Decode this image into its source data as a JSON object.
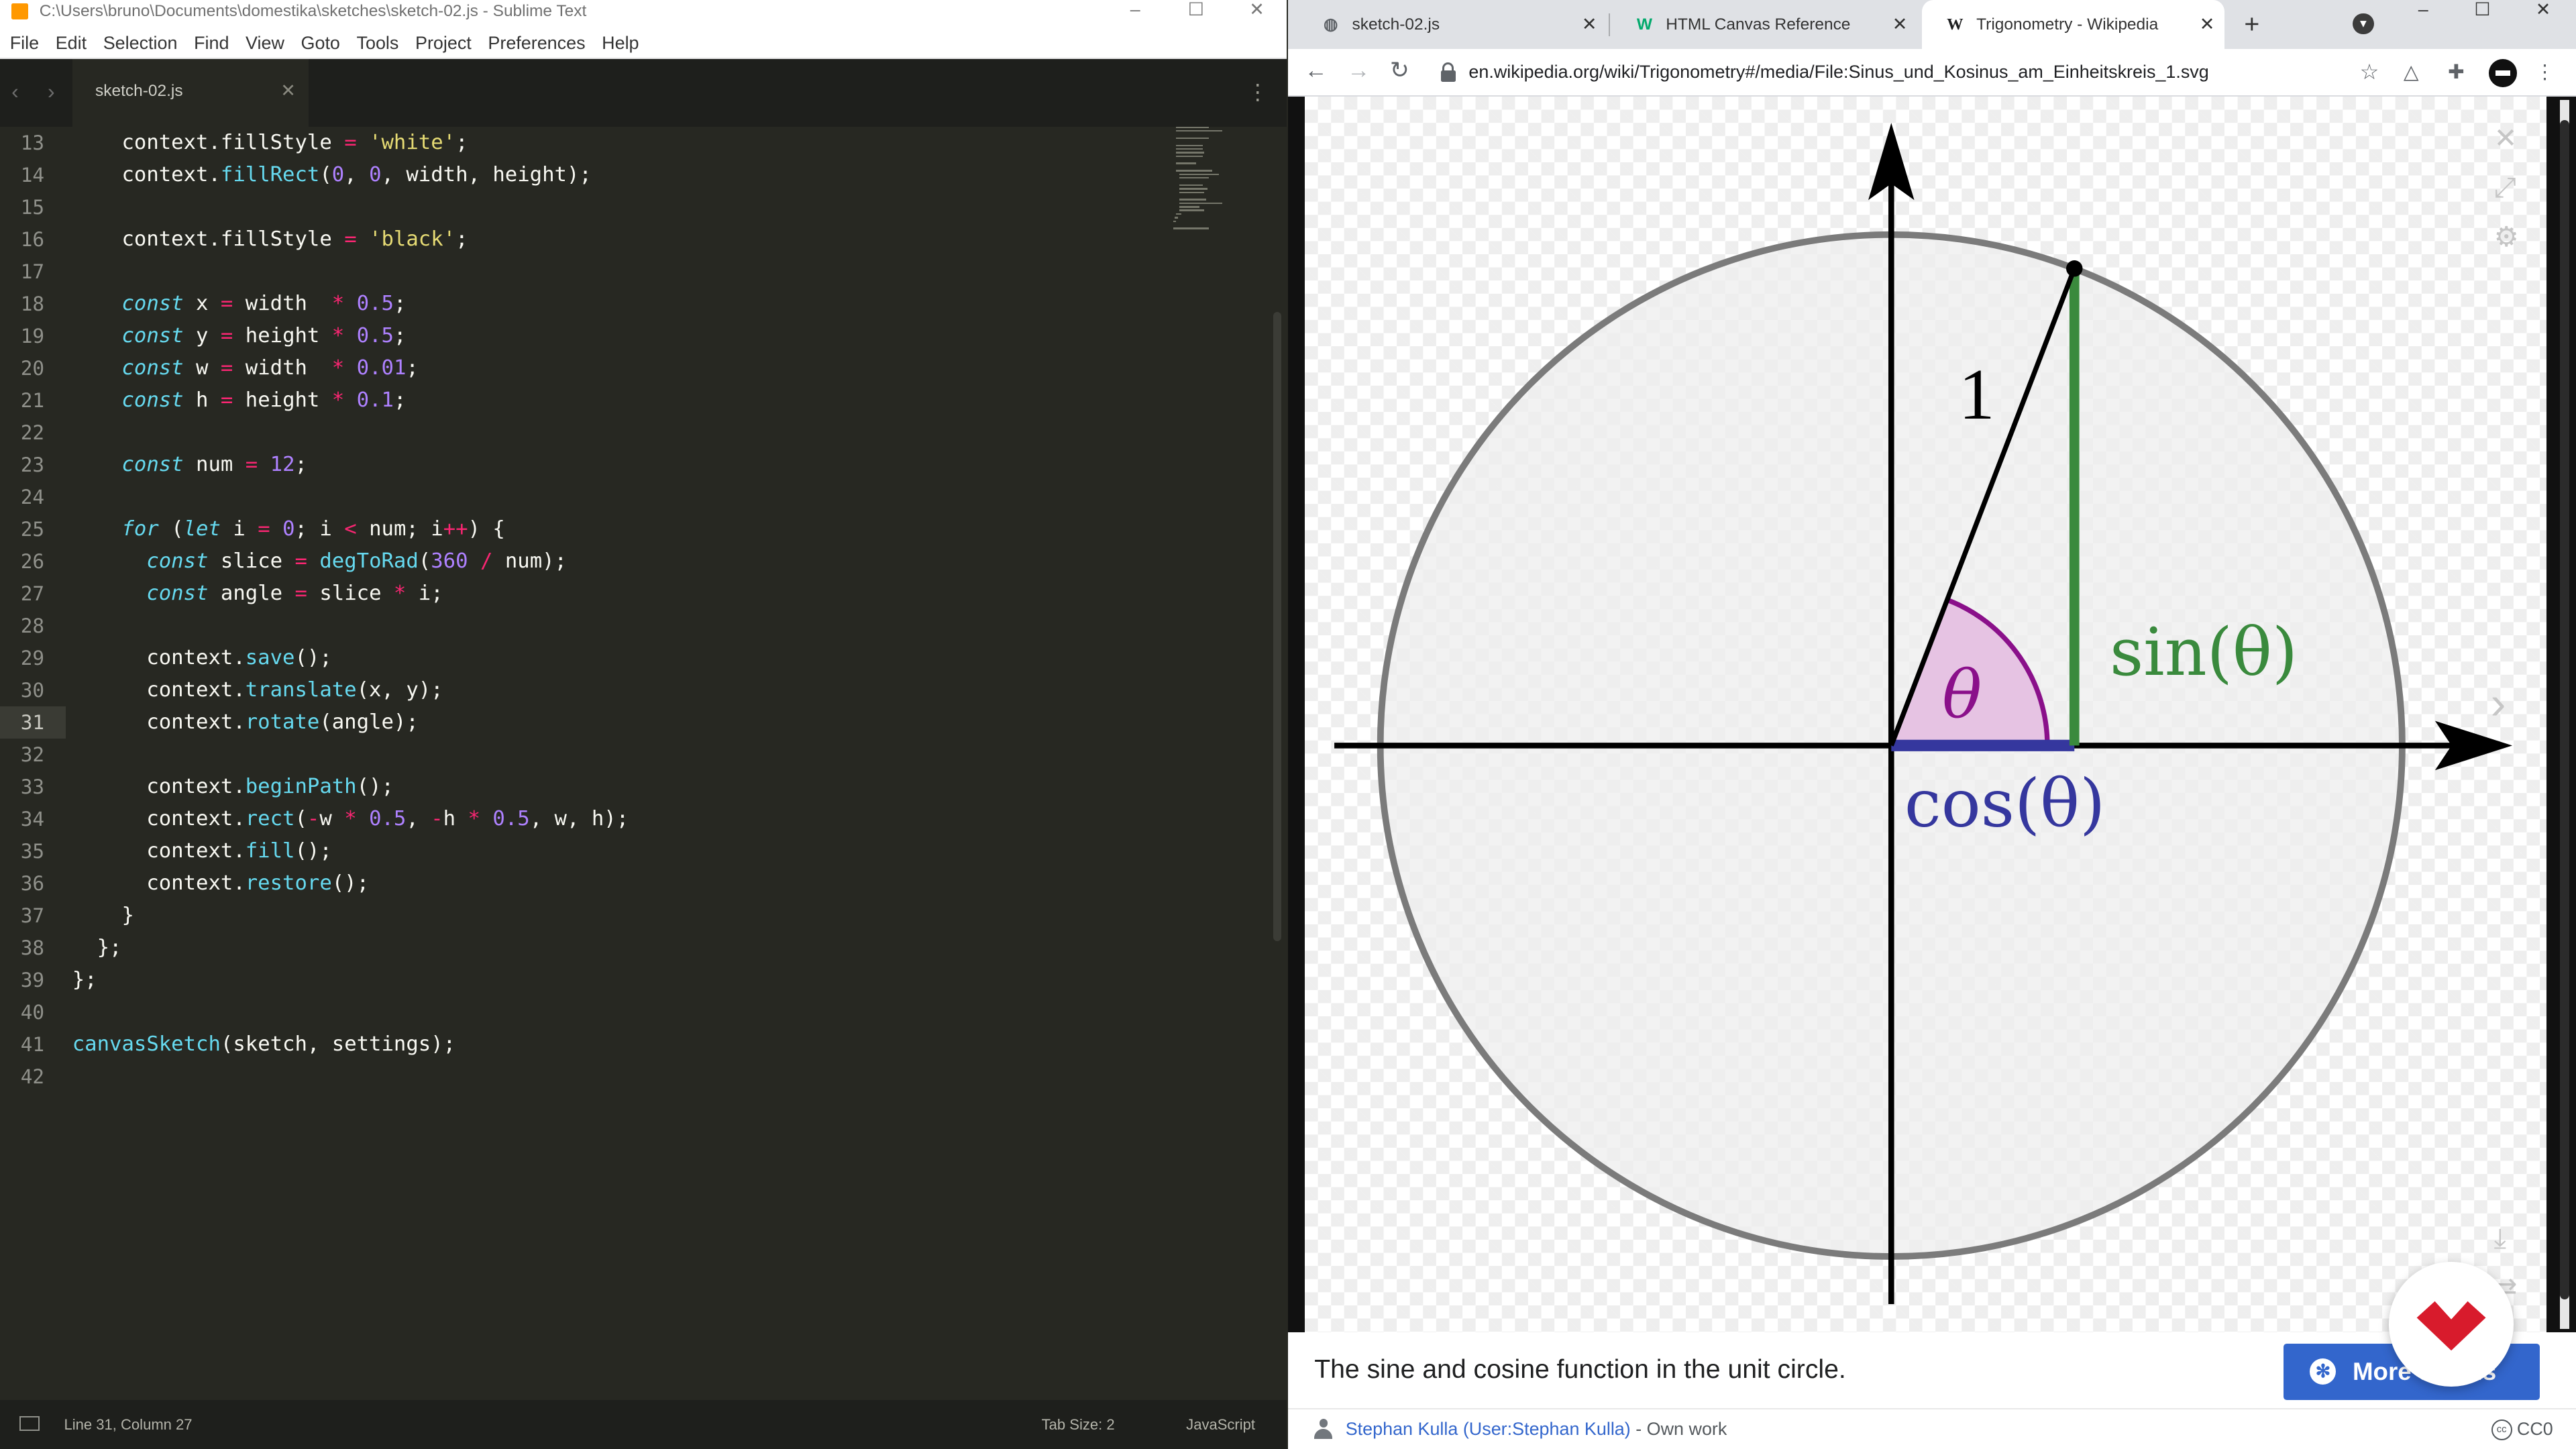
{
  "sublime": {
    "title": "C:\\Users\\bruno\\Documents\\domestika\\sketches\\sketch-02.js - Sublime Text",
    "menu": [
      "File",
      "Edit",
      "Selection",
      "Find",
      "View",
      "Goto",
      "Tools",
      "Project",
      "Preferences",
      "Help"
    ],
    "tab_label": "sketch-02.js",
    "status": {
      "position": "Line 31, Column 27",
      "tab_size": "Tab Size: 2",
      "syntax": "JavaScript"
    },
    "current_line": 31,
    "line_numbers": [
      "13",
      "14",
      "15",
      "16",
      "17",
      "18",
      "19",
      "20",
      "21",
      "22",
      "23",
      "24",
      "25",
      "26",
      "27",
      "28",
      "29",
      "30",
      "31",
      "32",
      "33",
      "34",
      "35",
      "36",
      "37",
      "38",
      "39",
      "40",
      "41",
      "42"
    ],
    "code_lines": [
      "    context.fillStyle = 'white';",
      "    context.fillRect(0, 0, width, height);",
      "",
      "    context.fillStyle = 'black';",
      "",
      "    const x = width  * 0.5;",
      "    const y = height * 0.5;",
      "    const w = width  * 0.01;",
      "    const h = height * 0.1;",
      "",
      "    const num = 12;",
      "",
      "    for (let i = 0; i < num; i++) {",
      "      const slice = degToRad(360 / num);",
      "      const angle = slice * i;",
      "",
      "      context.save();",
      "      context.translate(x, y);",
      "      context.rotate(angle);",
      "",
      "      context.beginPath();",
      "      context.rect(-w * 0.5, -h * 0.5, w, h);",
      "      context.fill();",
      "      context.restore();",
      "    }",
      "  };",
      "};",
      "",
      "canvasSketch(sketch, settings);",
      ""
    ]
  },
  "chrome": {
    "tabs": [
      {
        "label": "sketch-02.js",
        "icon": "globe-icon",
        "active": false
      },
      {
        "label": "HTML Canvas Reference",
        "icon": "w3schools-icon",
        "active": false
      },
      {
        "label": "Trigonometry - Wikipedia",
        "icon": "wikipedia-icon",
        "active": true
      }
    ],
    "url": "en.wikipedia.org/wiki/Trigonometry#/media/File:Sinus_und_Kosinus_am_Einheitskreis_1.svg",
    "caption": "The sine and cosine function in the unit circle.",
    "more_details": "More details",
    "author_link": "Stephan Kulla (User:Stephan Kulla)",
    "author_suffix": " - Own work",
    "license": "CC0",
    "figure": {
      "label_one": "1",
      "label_theta": "θ",
      "label_sin": "sin(θ)",
      "label_cos": "cos(θ)",
      "angle_deg": 69,
      "colors": {
        "sin": "#3a8a3d",
        "cos": "#35379e",
        "arc": "#8a108a",
        "wedge": "#e6c3e3",
        "circle": "#7b7b7b",
        "disk": "#ededed"
      }
    }
  }
}
